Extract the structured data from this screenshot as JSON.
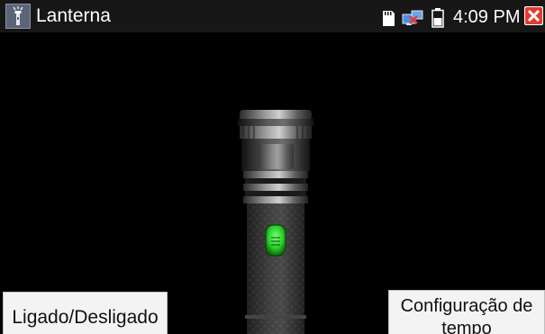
{
  "statusbar": {
    "title": "Lanterna",
    "time": "4:09 PM",
    "icons": [
      "flashlight-app-icon",
      "sd-card-icon",
      "network-icon",
      "battery-icon",
      "close-icon"
    ]
  },
  "buttons": {
    "toggle_label": "Ligado/Desligado",
    "timer_label": "Configuração de tempo"
  },
  "colors": {
    "background": "#000000",
    "statusbar": "#171717",
    "close_red": "#e23b2e",
    "switch_green": "#2bd12b"
  }
}
